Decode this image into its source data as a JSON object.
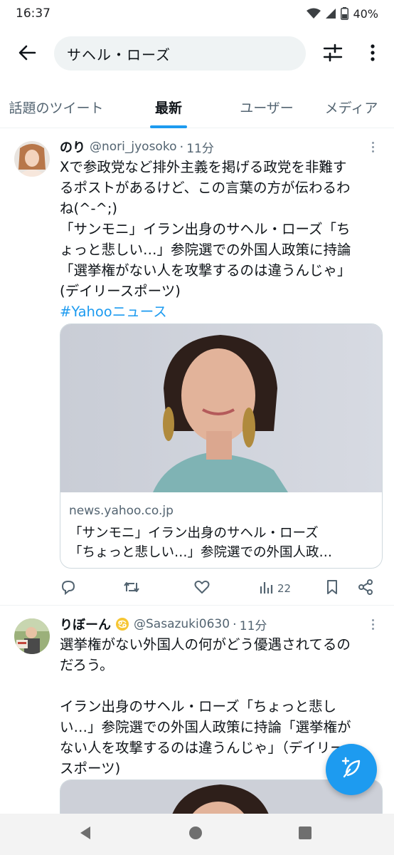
{
  "status_bar": {
    "time": "16:37",
    "battery": "40%",
    "icons": [
      "wifi-icon",
      "signal-icon",
      "battery-icon"
    ]
  },
  "search": {
    "query": "サヘル・ローズ",
    "icons": [
      "back-arrow-icon",
      "filter-sliders-icon",
      "more-vertical-icon"
    ]
  },
  "tabs": [
    {
      "label": "話題のツイート",
      "active": false
    },
    {
      "label": "最新",
      "active": true
    },
    {
      "label": "ユーザー",
      "active": false
    },
    {
      "label": "メディア",
      "active": false
    }
  ],
  "tweets": [
    {
      "name": "のり",
      "handle": "@nori_jyosoko",
      "separator": "·",
      "time": "11分",
      "lines": [
        "Xで参政党など排外主義を掲げる政党を非難す",
        "るポストがあるけど、この言葉の方が伝わるわ",
        "ね(^-^;)",
        "「サンモニ」イラン出身のサヘル・ローズ「ち",
        "ょっと悲しい…」参院選での外国人政策に持論",
        "「選挙権がない人を攻撃するのは違うんじゃ」",
        "(デイリースポーツ)"
      ],
      "hashtag": "#Yahooニュース",
      "card": {
        "domain": "news.yahoo.co.jp",
        "title_line1": "「サンモニ」イラン出身のサヘル・ローズ",
        "title_line2": "「ちょっと悲しい…」参院選での外国人政…"
      },
      "actions": {
        "icons": [
          "reply-icon",
          "retweet-icon",
          "like-icon",
          "views-icon",
          "bookmark-icon",
          "share-icon"
        ],
        "views": "22"
      }
    },
    {
      "name": "りぼーん",
      "badge_icon": "cancer-zodiac-icon",
      "handle": "@Sasazuki0630",
      "separator": "·",
      "time": "11分",
      "lines": [
        "選挙権がない外国人の何がどう優遇されてるの",
        "だろう。",
        "",
        "イラン出身のサヘル・ローズ「ちょっと悲し",
        "い…」参院選での外国人政策に持論「選挙権が",
        "ない人を攻撃するのは違うんじゃ」（デイリー",
        "スポーツ)"
      ]
    }
  ],
  "fab": {
    "icon": "compose-feather-icon"
  },
  "navbar": {
    "icons": [
      "nav-back-icon",
      "nav-home-icon",
      "nav-recents-icon"
    ]
  },
  "colors": {
    "accent": "#1d9bf0",
    "text": "#0f1419",
    "secondary": "#536471",
    "search_bg": "#eff3f4"
  }
}
